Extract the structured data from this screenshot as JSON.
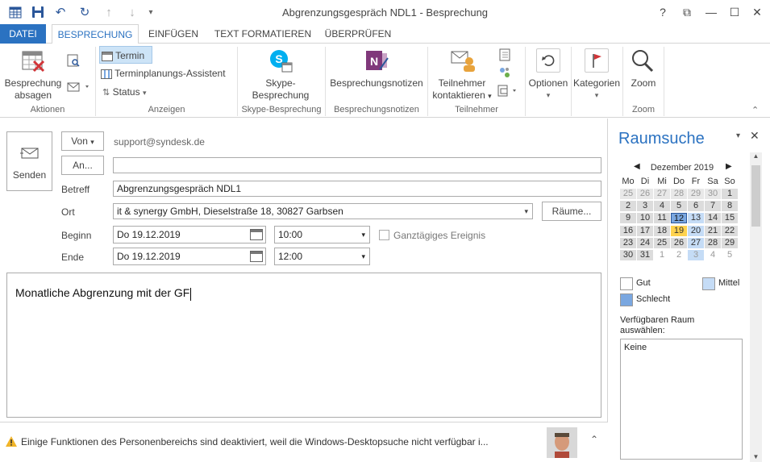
{
  "window": {
    "title": "Abgrenzungsgespräch NDL1 - Besprechung",
    "help": "?",
    "restore_ribbon": "⧉",
    "minimize": "—",
    "maximize": "☐",
    "close": "✕"
  },
  "quick_access": {
    "icons": [
      "calendar-icon",
      "save-icon",
      "undo-icon",
      "redo-icon",
      "up-icon",
      "down-icon",
      "customize-icon"
    ]
  },
  "tabs": [
    "DATEI",
    "BESPRECHUNG",
    "EINFÜGEN",
    "TEXT FORMATIEREN",
    "ÜBERPRÜFEN"
  ],
  "ribbon": {
    "aktionen": {
      "label": "Aktionen",
      "cancel_line1": "Besprechung",
      "cancel_line2": "absagen"
    },
    "anzeigen": {
      "label": "Anzeigen",
      "termin": "Termin",
      "assistent": "Terminplanungs-Assistent",
      "status": "Status"
    },
    "skype": {
      "label": "Skype-Besprechung",
      "line1": "Skype-",
      "line2": "Besprechung"
    },
    "notizen": {
      "label": "Besprechungsnotizen",
      "button": "Besprechungsnotizen"
    },
    "teilnehmer": {
      "label": "Teilnehmer",
      "line1": "Teilnehmer",
      "line2": "kontaktieren"
    },
    "optionen": {
      "button": "Optionen"
    },
    "kategorien": {
      "button": "Kategorien"
    },
    "zoom": {
      "label": "Zoom",
      "button": "Zoom"
    }
  },
  "form": {
    "send": "Senden",
    "von": "Von",
    "from_address": "support@syndesk.de",
    "an": "An...",
    "to_value": "",
    "betreff_label": "Betreff",
    "betreff": "Abgrenzungsgespräch NDL1",
    "ort_label": "Ort",
    "ort": "it & synergy GmbH, Dieselstraße 18, 30827 Garbsen",
    "raeume": "Räume...",
    "beginn_label": "Beginn",
    "beginn_date": "Do 19.12.2019",
    "beginn_time": "10:00",
    "allday": "Ganztägiges Ereignis",
    "ende_label": "Ende",
    "ende_date": "Do 19.12.2019",
    "ende_time": "12:00",
    "body": "Monatliche Abgrenzung mit der GF"
  },
  "status_bar": {
    "message": "Einige Funktionen des Personenbereichs sind deaktiviert, weil die Windows-Desktopsuche nicht verfügbar i..."
  },
  "raumsuche": {
    "title": "Raumsuche",
    "month": "Dezember 2019",
    "weekdays": [
      "Mo",
      "Di",
      "Mi",
      "Do",
      "Fr",
      "Sa",
      "So"
    ],
    "weeks": [
      [
        "25",
        "26",
        "27",
        "28",
        "29",
        "30",
        "1"
      ],
      [
        "2",
        "3",
        "4",
        "5",
        "6",
        "7",
        "8"
      ],
      [
        "9",
        "10",
        "11",
        "12",
        "13",
        "14",
        "15"
      ],
      [
        "16",
        "17",
        "18",
        "19",
        "20",
        "21",
        "22"
      ],
      [
        "23",
        "24",
        "25",
        "26",
        "27",
        "28",
        "29"
      ],
      [
        "30",
        "31",
        "1",
        "2",
        "3",
        "4",
        "5"
      ]
    ],
    "legend_gut": "Gut",
    "legend_mittel": "Mittel",
    "legend_schlecht": "Schlecht",
    "avail_line1": "Verfügbaren Raum",
    "avail_line2": "auswählen:",
    "avail_value": "Keine",
    "colors": {
      "gut": "#ffffff",
      "mittel": "#c5dcf6",
      "schlecht": "#7aa7e0",
      "selected": "#ffd34f",
      "accent": "#2b72c1"
    }
  }
}
